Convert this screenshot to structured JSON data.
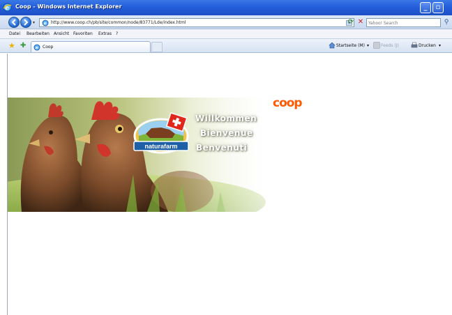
{
  "window": {
    "title": "Coop - Windows Internet Explorer"
  },
  "address_bar": {
    "url": "http://www.coop.ch/pb/site/common/node/83771/Lde/index.html"
  },
  "search": {
    "placeholder": "Yahoo! Search"
  },
  "menu": [
    "Datei",
    "Bearbeiten",
    "Ansicht",
    "Favoriten",
    "Extras",
    "?"
  ],
  "tab": {
    "label": "Coop"
  },
  "command_bar": {
    "home": "Startseite (M)",
    "feeds": "Feeds (J)",
    "print": "Drucken"
  },
  "page": {
    "brand": "coop",
    "greeting_de": "Willkommen",
    "greeting_fr": "Bienvenue",
    "greeting_it": "Benvenuti",
    "badge": "naturafarm"
  },
  "colors": {
    "titlebar": "#245edb",
    "coop_orange": "#ff5a00",
    "badge_blue": "#1f5fa8",
    "swiss_red": "#e1261c"
  },
  "icons": {
    "back": "back-arrow-icon",
    "forward": "forward-arrow-icon",
    "refresh": "refresh-icon",
    "stop": "stop-icon",
    "search": "search-icon",
    "favorites": "favorites-star-icon",
    "home": "home-icon",
    "feeds": "feed-icon",
    "print": "printer-icon"
  }
}
